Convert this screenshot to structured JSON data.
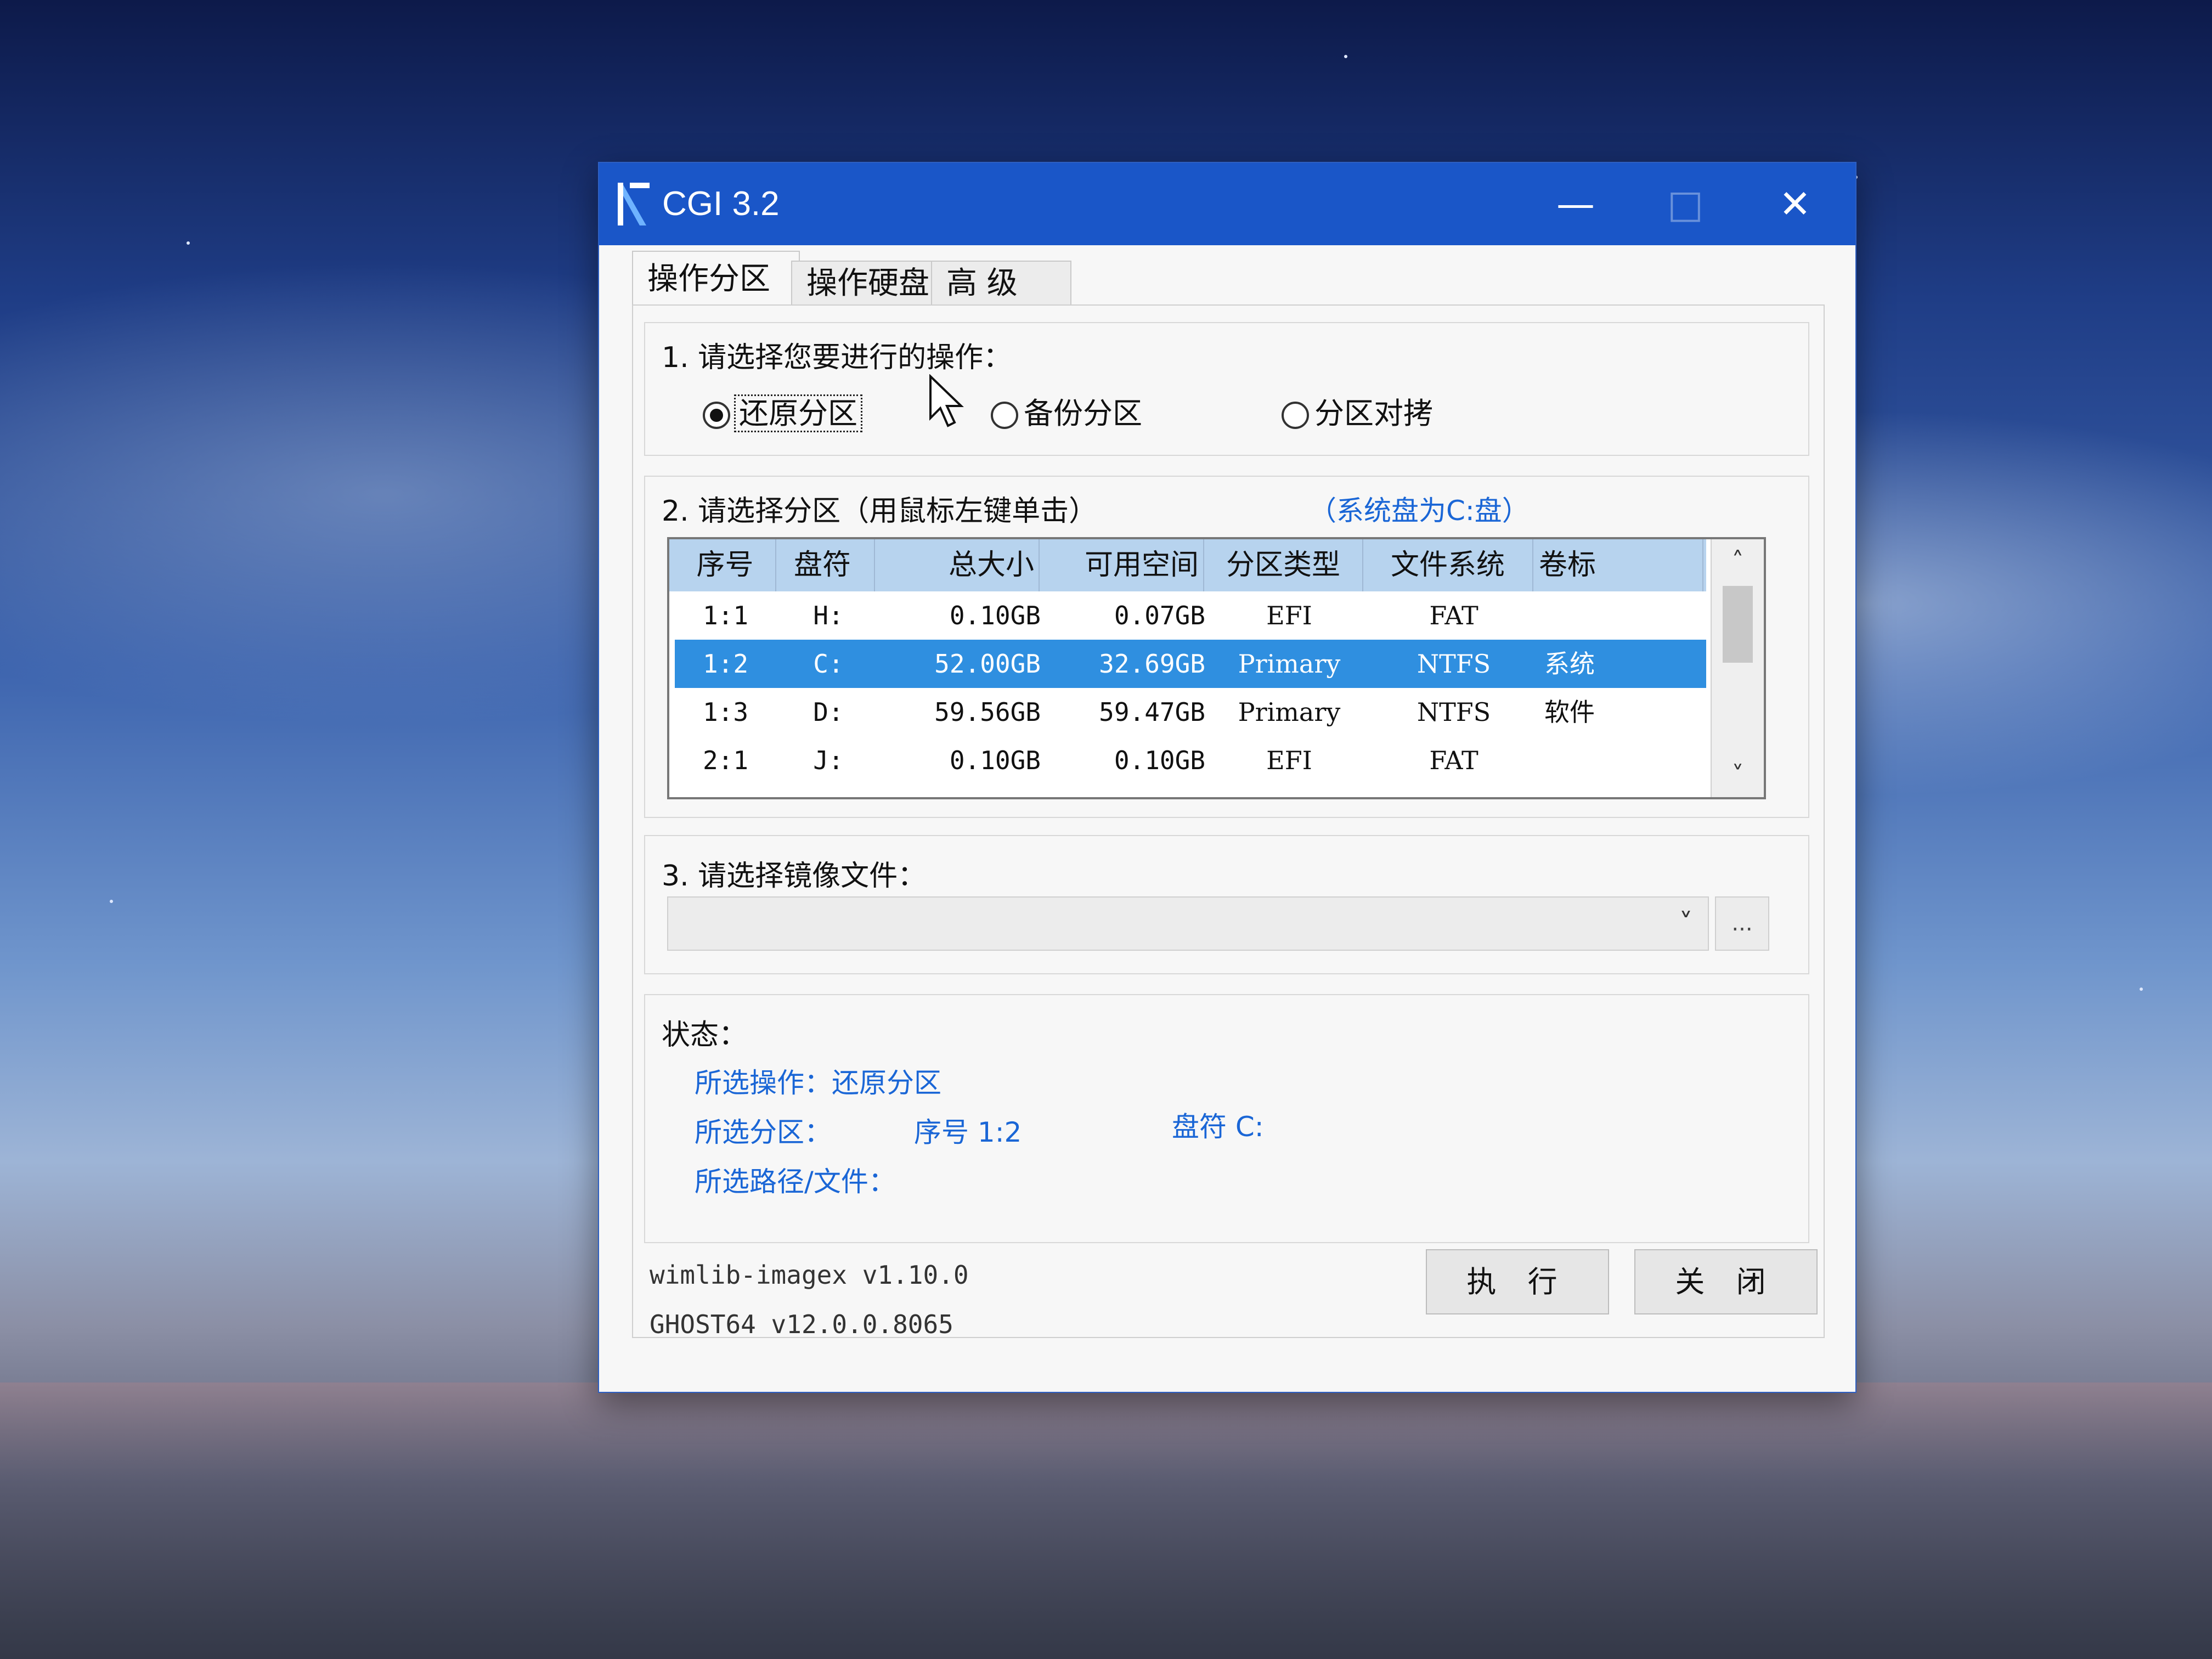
{
  "window": {
    "title": "CGI 3.2",
    "controls": {
      "minimize": "—",
      "maximize": "□",
      "close": "✕"
    }
  },
  "tabs": [
    {
      "label": "操作分区",
      "active": true
    },
    {
      "label": "操作硬盘",
      "active": false
    },
    {
      "label": "高 级",
      "active": false
    }
  ],
  "step1": {
    "label": "1. 请选择您要进行的操作：",
    "options": [
      {
        "label": "还原分区",
        "selected": true
      },
      {
        "label": "备份分区",
        "selected": false
      },
      {
        "label": "分区对拷",
        "selected": false
      }
    ]
  },
  "step2": {
    "label": "2. 请选择分区（用鼠标左键单击）",
    "note": "（系统盘为C:盘）",
    "columns": [
      "序号",
      "盘符",
      "总大小",
      "可用空间",
      "分区类型",
      "文件系统",
      "卷标"
    ],
    "rows": [
      {
        "index": "1:1",
        "letter": "H:",
        "total": "0.10GB",
        "free": "0.07GB",
        "type": "EFI",
        "fs": "FAT",
        "label": "",
        "selected": false
      },
      {
        "index": "1:2",
        "letter": "C:",
        "total": "52.00GB",
        "free": "32.69GB",
        "type": "Primary",
        "fs": "NTFS",
        "label": "系统",
        "selected": true
      },
      {
        "index": "1:3",
        "letter": "D:",
        "total": "59.56GB",
        "free": "59.47GB",
        "type": "Primary",
        "fs": "NTFS",
        "label": "软件",
        "selected": false
      },
      {
        "index": "2:1",
        "letter": "J:",
        "total": "0.10GB",
        "free": "0.10GB",
        "type": "EFI",
        "fs": "FAT",
        "label": "",
        "selected": false
      }
    ],
    "scroll_up": "˄",
    "scroll_down": "˅"
  },
  "step3": {
    "label": "3. 请选择镜像文件：",
    "value": "",
    "dropdown_icon": "˅",
    "browse_label": "..."
  },
  "status": {
    "label": "状态：",
    "operation": "所选操作：还原分区",
    "partition": "所选分区：",
    "partition_index": "序号 1:2",
    "partition_letter": "盘符 C:",
    "path": "所选路径/文件："
  },
  "footer": {
    "wimlib_version": "wimlib-imagex v1.10.0",
    "ghost_version": "GHOST64 v12.0.0.8065",
    "execute_label": "执 行",
    "close_label": "关 闭"
  },
  "colors": {
    "titlebar": "#1a56c8",
    "selection": "#2f8fe0",
    "header": "#b7d3ee",
    "status_text": "#1a66d6"
  }
}
